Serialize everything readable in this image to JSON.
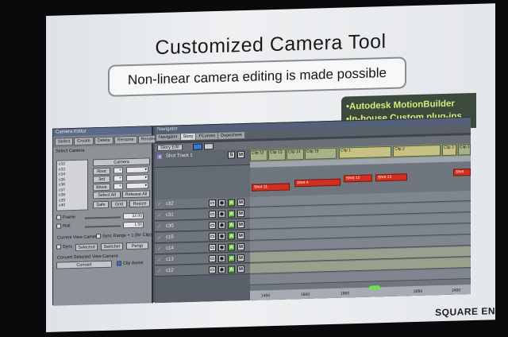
{
  "slide": {
    "title": "Customized Camera Tool",
    "subtitle": "Non-linear camera editing is made possible",
    "tools": [
      "•Autodesk MotionBuilder",
      "•In-house Custom plug-ins"
    ],
    "watermark": "SQUARE EN"
  },
  "left_panel": {
    "title": "Camera Editor",
    "tabs": [
      "Select",
      "Create",
      "Delete",
      "Rename",
      "Render"
    ],
    "select_camera_label": "Select Camera",
    "camera_items": [
      "c32",
      "c33",
      "c34",
      "c35",
      "c36",
      "c37",
      "c38",
      "c39",
      "c40"
    ],
    "camera_header": "Camera",
    "buttons": {
      "root": "Root",
      "all": "3rd",
      "move": "Move",
      "select_all": "Select All",
      "release_all": "Release All",
      "safe": "Safe",
      "grid": "Grid",
      "resize": "Resize",
      "selected": "Selected",
      "switcher": "Switcher",
      "persp": "Persp",
      "convert": "Convert"
    },
    "fields": {
      "frame_value": "32.00",
      "roll_value": "1.50"
    },
    "checks": {
      "frame": "Frame",
      "roll": "Roll",
      "sync": "Sync",
      "sync_range": "Sync Range + 1 (for Clip)",
      "clip_assist": "Clip Assist"
    },
    "labels": {
      "current_view": "Current View Camera",
      "convert_selected": "Convert Selected View Camera"
    }
  },
  "right_panel": {
    "title": "Navigator",
    "tabs": [
      "Navigator",
      "Story",
      "FCurves",
      "Dopesheet"
    ],
    "active_tab": "Story",
    "story_label": "Story Edit",
    "shot_track": "Shot Track 1",
    "tracks": [
      "c32",
      "c31",
      "c30",
      "c15",
      "c14",
      "c13",
      "c12"
    ],
    "clips": [
      "Clip 12",
      "Clip 13",
      "Clip 14",
      "Clip 15",
      "Clip 1",
      "Clip 2",
      "Clip 3",
      "Clip 1"
    ],
    "shots": [
      "Shot 11",
      "Shot 4",
      "Shot 12",
      "Shot 13",
      "Shot"
    ],
    "ruler_ticks": [
      "1450",
      "1600",
      "1850",
      "2050",
      "2400"
    ]
  }
}
